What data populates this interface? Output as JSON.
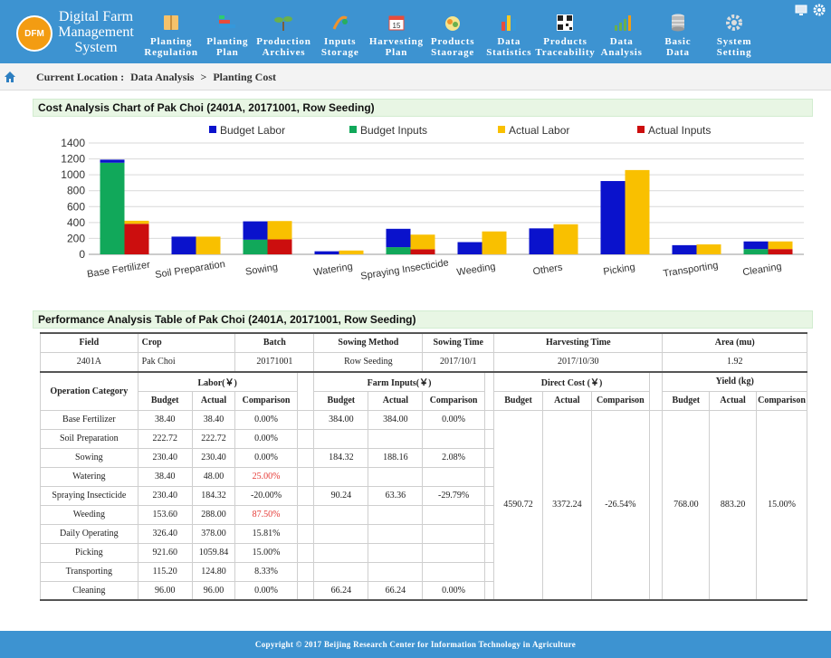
{
  "app": {
    "logo_text": "DFM",
    "title_lines": [
      "Digital Farm",
      "Management",
      "System"
    ]
  },
  "nav": [
    {
      "lines": [
        "Planting",
        "Regulation"
      ],
      "icon": "book-icon",
      "color": "#f5c26b"
    },
    {
      "lines": [
        "Planting",
        "Plan"
      ],
      "icon": "bar-chart-icon",
      "color": "#e74c3c"
    },
    {
      "lines": [
        "Production",
        "Archives"
      ],
      "icon": "sprout-icon",
      "color": "#6ab04c"
    },
    {
      "lines": [
        "Inputs",
        "Storage"
      ],
      "icon": "seedling-icon",
      "color": "#f0932b"
    },
    {
      "lines": [
        "Harvesting",
        "Plan"
      ],
      "icon": "calendar-icon",
      "color": "#ffffff"
    },
    {
      "lines": [
        "Products",
        "Staorage"
      ],
      "icon": "produce-icon",
      "color": "#f6e58d"
    },
    {
      "lines": [
        "Data",
        "Statistics"
      ],
      "icon": "column-chart-icon",
      "color": "#f9ca24"
    },
    {
      "lines": [
        "Products",
        "Traceability"
      ],
      "icon": "qr-code-icon",
      "color": "#222222"
    },
    {
      "lines": [
        "Data",
        "Analysis"
      ],
      "icon": "growth-chart-icon",
      "color": "#6ab04c"
    },
    {
      "lines": [
        "Basic",
        "Data"
      ],
      "icon": "database-icon",
      "color": "#dddddd"
    },
    {
      "lines": [
        "System",
        "Setting"
      ],
      "icon": "gear-icon",
      "color": "#dddddd"
    }
  ],
  "breadcrumb": {
    "label": "Current Location :",
    "path": [
      "Data Analysis",
      "Planting Cost"
    ],
    "separator": ">"
  },
  "chart_section_title": "Cost Analysis Chart of Pak Choi (2401A, 20171001, Row Seeding)",
  "table_section_title": "Performance Analysis Table of Pak Choi (2401A, 20171001, Row Seeding)",
  "chart_data": {
    "type": "bar",
    "stacked_groups": true,
    "categories": [
      "Base Fertilizer",
      "Soil Preparation",
      "Sowing",
      "Watering",
      "Spraying Insecticide",
      "Weeding",
      "Others",
      "Picking",
      "Transporting",
      "Cleaning"
    ],
    "series": [
      {
        "name": "Budget Labor",
        "color": "#0a12cc",
        "stack": "budget",
        "values": [
          38.4,
          222.72,
          230.4,
          38.4,
          230.6,
          153.6,
          326.4,
          921.6,
          115.2,
          96.0
        ]
      },
      {
        "name": "Budget Inputs",
        "color": "#11a85a",
        "stack": "budget",
        "values": [
          1152,
          0,
          184.32,
          0,
          90.24,
          0,
          0,
          0,
          0,
          66.24
        ]
      },
      {
        "name": "Actual Labor",
        "color": "#f9c000",
        "stack": "actual",
        "values": [
          38.4,
          222.72,
          230.4,
          48.0,
          184.32,
          288.0,
          378.0,
          1059.84,
          124.8,
          96.0
        ]
      },
      {
        "name": "Actual Inputs",
        "color": "#cc0e0e",
        "stack": "actual",
        "values": [
          384.0,
          0,
          188.16,
          0,
          63.36,
          0,
          0,
          0,
          0,
          66.24
        ]
      }
    ],
    "ylim": [
      0,
      1400
    ],
    "yticks": [
      0,
      200,
      400,
      600,
      800,
      1000,
      1200,
      1400
    ],
    "grid": true,
    "legend_position": "top"
  },
  "table": {
    "info_headers": [
      "Field",
      "Crop",
      "Batch",
      "Sowing Method",
      "Sowing Time",
      "Harvesting Time",
      "Area (mu)"
    ],
    "info_values": [
      "2401A",
      "Pak Choi",
      "20171001",
      "Row Seeding",
      "2017/10/1",
      "2017/10/30",
      "1.92"
    ],
    "category_header": "Operation Category",
    "group_headers": [
      "Labor(￥)",
      "Farm Inputs(￥)",
      "Direct Cost (￥)",
      "Yield (kg)"
    ],
    "sub_headers": [
      "Budget",
      "Actual",
      "Comparison"
    ],
    "rows": [
      {
        "cat": "Base Fertilizer",
        "lb": "38.40",
        "la": "38.40",
        "lc": "0.00%",
        "ib": "384.00",
        "ia": "384.00",
        "ic": "0.00%"
      },
      {
        "cat": "Soil Preparation",
        "lb": "222.72",
        "la": "222.72",
        "lc": "0.00%",
        "ib": "",
        "ia": "",
        "ic": ""
      },
      {
        "cat": "Sowing",
        "lb": "230.40",
        "la": "230.40",
        "lc": "0.00%",
        "ib": "184.32",
        "ia": "188.16",
        "ic": "2.08%"
      },
      {
        "cat": "Watering",
        "lb": "38.40",
        "la": "48.00",
        "lc": "25.00%",
        "ib": "",
        "ia": "",
        "ic": ""
      },
      {
        "cat": "Spraying Insecticide",
        "lb": "230.40",
        "la": "184.32",
        "lc": "-20.00%",
        "ib": "90.24",
        "ia": "63.36",
        "ic": "-29.79%"
      },
      {
        "cat": "Weeding",
        "lb": "153.60",
        "la": "288.00",
        "lc": "87.50%",
        "ib": "",
        "ia": "",
        "ic": ""
      },
      {
        "cat": "Daily Operating",
        "lb": "326.40",
        "la": "378.00",
        "lc": "15.81%",
        "ib": "",
        "ia": "",
        "ic": ""
      },
      {
        "cat": "Picking",
        "lb": "921.60",
        "la": "1059.84",
        "lc": "15.00%",
        "ib": "",
        "ia": "",
        "ic": ""
      },
      {
        "cat": "Transporting",
        "lb": "115.20",
        "la": "124.80",
        "lc": "8.33%",
        "ib": "",
        "ia": "",
        "ic": ""
      },
      {
        "cat": "Cleaning",
        "lb": "96.00",
        "la": "96.00",
        "lc": "0.00%",
        "ib": "66.24",
        "ia": "66.24",
        "ic": "0.00%"
      }
    ],
    "highlight_red": [
      "25.00%",
      "87.50%"
    ],
    "direct_cost": {
      "budget": "4590.72",
      "actual": "3372.24",
      "comparison": "-26.54%"
    },
    "yield": {
      "budget": "768.00",
      "actual": "883.20",
      "comparison": "15.00%"
    }
  },
  "footer": "Copyright © 2017 Beijing Research Center for Information Technology in Agriculture"
}
